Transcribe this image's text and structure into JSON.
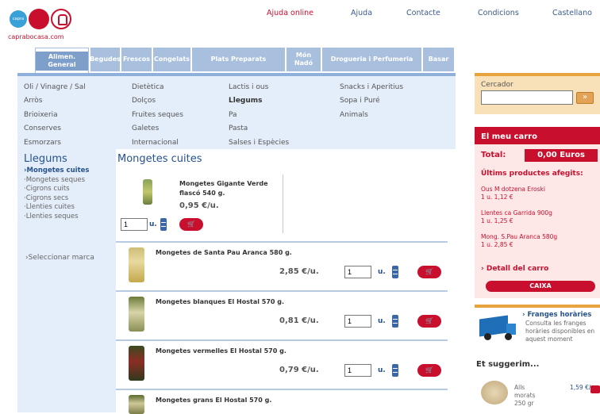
{
  "header": {
    "logo_badge": "capra",
    "site_url": "caprabocasa.com",
    "links": [
      "Ajuda online",
      "Ajuda",
      "Contacte",
      "Condicions",
      "Castellano"
    ]
  },
  "nav": {
    "tabs": [
      "Alimen. General",
      "Begudes",
      "Frescos",
      "Congelats",
      "Plats Preparats",
      "Món Nadó",
      "Drogueria i Perfumeria",
      "Basar"
    ]
  },
  "subnav": {
    "columns": [
      [
        "Oli / Vinagre / Sal",
        "Arròs",
        "Brioixeria",
        "Conserves",
        "Esmorzars"
      ],
      [
        "Dietètica",
        "Dolços",
        "Fruites seques",
        "Galetes",
        "Internacional"
      ],
      [
        "Lactis i ous",
        "Llegums",
        "Pa",
        "Pasta",
        "Salses i Espècies"
      ],
      [
        "Snacks i Aperitius",
        "Sopa i Puré",
        "Animals"
      ]
    ]
  },
  "sidebar": {
    "title": "Llegums",
    "items": [
      "Mongetes cuites",
      "Mongetes seques",
      "Cigrons cuits",
      "Cigrons secs",
      "Llenties cuites",
      "Llenties seques"
    ],
    "brand_link": "Seleccionar marca"
  },
  "main": {
    "title": "Mongetes cuites",
    "unit_label": "u.",
    "cart_label": "🛒",
    "featured": {
      "name": "Mongetes Gigante Verde flascó 540 g.",
      "price": "0,95 €/u.",
      "qty": "1"
    },
    "products": [
      {
        "name": "Mongetes de Santa Pau Aranca 580 g.",
        "price": "2,85 €/u.",
        "qty": "1"
      },
      {
        "name": "Mongetes blanques El Hostal 570 g.",
        "price": "0,81 €/u.",
        "qty": "1"
      },
      {
        "name": "Mongetes vermelles El Hostal 570 g.",
        "price": "0,79 €/u.",
        "qty": "1"
      },
      {
        "name": "Mongetes grans El Hostal 570 g.",
        "price": "",
        "qty": ""
      }
    ]
  },
  "search": {
    "label": "Cercador",
    "value": ""
  },
  "cart": {
    "header": "El meu carro",
    "total_label": "Total:",
    "total_value": "0,00 Euros",
    "last_added_label": "Últims productes afegits:",
    "items": [
      {
        "name": "Ous M dotzena Eroski",
        "detail": "1 u. 1,12 €"
      },
      {
        "name": "Llentes ca Garrida 900g",
        "detail": "1 u. 1,25 €"
      },
      {
        "name": "Mong. S.Pau Aranca 580g",
        "detail": "1 u. 2,85 €"
      }
    ],
    "detail_link": "Detall del carro",
    "checkout": "CAIXA"
  },
  "franges": {
    "title": "Franges horàries",
    "text": "Consulta les franges horàries disponibles en aquest moment"
  },
  "suggestion": {
    "title": "Et suggerim...",
    "name": "Alls morats 250 gr",
    "price": "1,59 €/u."
  },
  "colors": {
    "brand_red": "#c8102e",
    "nav_blue": "#a8bfdd",
    "link_blue": "#27528c",
    "panel": "#e4eefa",
    "accent_orange": "#e7a33c"
  }
}
